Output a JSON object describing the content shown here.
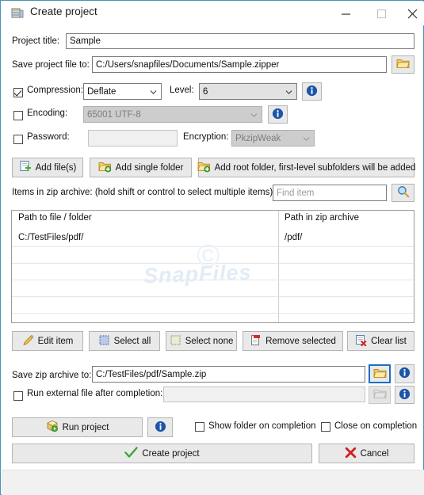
{
  "window": {
    "title": "Create project",
    "app_icon": "archive-app-icon",
    "minimize_label": "—",
    "maximize_label": "□",
    "close_label": "✕"
  },
  "project": {
    "title_label": "Project title:",
    "title_value": "Sample",
    "save_file_label": "Save project file to:",
    "save_file_value": "C:/Users/snapfiles/Documents/Sample.zipper",
    "browse_icon": "folder-icon"
  },
  "options": {
    "compression_label": "Compression:",
    "compression_checked": true,
    "compression_value": "Deflate",
    "level_label": "Level:",
    "level_value": "6",
    "compression_info_icon": "info-icon",
    "encoding_label": "Encoding:",
    "encoding_checked": false,
    "encoding_value": "65001 UTF-8",
    "encoding_info_icon": "info-icon",
    "password_label": "Password:",
    "password_checked": false,
    "password_value": "",
    "encryption_label": "Encryption:",
    "encryption_value": "PkzipWeak"
  },
  "add_buttons": {
    "add_files": "Add file(s)",
    "add_files_icon": "file-add-icon",
    "add_single_folder": "Add single folder",
    "add_single_folder_icon": "folder-add-icon",
    "add_root_folder": "Add root folder, first-level subfolders will be added",
    "add_root_folder_icon": "folder-add-icon"
  },
  "items_section": {
    "label": "Items in zip archive: (hold shift or control to select multiple items)",
    "find_placeholder": "Find item",
    "find_value": "",
    "search_icon": "magnifier-icon",
    "columns": [
      "Path to file / folder",
      "Path in zip archive"
    ],
    "rows": [
      {
        "path": "C:/TestFiles/pdf/",
        "zip_path": "/pdf/"
      }
    ],
    "empty_rows": 5,
    "watermark": "SnapFiles"
  },
  "list_buttons": {
    "edit_item": "Edit item",
    "edit_item_icon": "pencil-icon",
    "select_all": "Select all",
    "select_all_icon": "select-all-icon",
    "select_none": "Select none",
    "select_none_icon": "select-none-icon",
    "remove_selected": "Remove selected",
    "remove_selected_icon": "remove-icon",
    "clear_list": "Clear list",
    "clear_list_icon": "clear-list-icon"
  },
  "output": {
    "save_zip_label": "Save zip archive to:",
    "save_zip_value": "C:/TestFiles/pdf/Sample.zip",
    "save_zip_browse_icon": "folder-icon",
    "save_zip_info_icon": "info-icon",
    "run_external_label": "Run external file after completion:",
    "run_external_checked": false,
    "run_external_value": "",
    "run_external_browse_icon": "folder-icon",
    "run_external_info_icon": "info-icon"
  },
  "actions": {
    "run_project": "Run project",
    "run_project_icon": "package-run-icon",
    "run_project_info_icon": "info-icon",
    "show_folder_label": "Show folder on completion",
    "show_folder_checked": false,
    "close_on_completion_label": "Close on completion",
    "close_on_completion_checked": false,
    "create_project": "Create project",
    "create_project_icon": "green-check-icon",
    "cancel": "Cancel",
    "cancel_icon": "red-x-icon"
  },
  "colors": {
    "window_border": "#4a93b5",
    "accent_focus": "#1a6fc4",
    "info_blue": "#1b55a8",
    "check_green": "#35a03a",
    "cancel_red": "#d01f1f",
    "folder_yellow": "#f0c14b"
  }
}
